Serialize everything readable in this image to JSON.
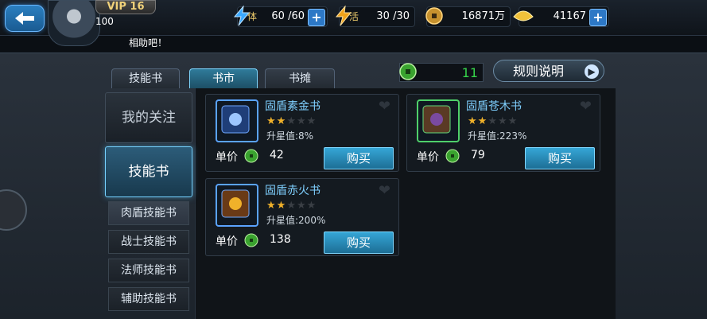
{
  "header": {
    "vip": "VIP 16",
    "level": "100",
    "stamina": {
      "label": "体",
      "value": "60 /60"
    },
    "energy": {
      "label": "活",
      "value": "30 /30"
    },
    "coins": {
      "value": "16871万"
    },
    "gold": {
      "value": "41167"
    },
    "marquee": "相助吧！"
  },
  "tabs": [
    {
      "label": "技能书"
    },
    {
      "label": "书市"
    },
    {
      "label": "书摊"
    }
  ],
  "currency": {
    "value": "11"
  },
  "rules_button": {
    "label": "规则说明"
  },
  "sidebar": {
    "categories": [
      {
        "label": "我的关注"
      },
      {
        "label": "技能书"
      }
    ],
    "subitems": [
      {
        "label": "肉盾技能书"
      },
      {
        "label": "战士技能书"
      },
      {
        "label": "法师技能书"
      },
      {
        "label": "辅助技能书"
      }
    ]
  },
  "cards": [
    {
      "name": "固盾素金书",
      "stars": 2,
      "upgrade": "升星值:8%",
      "price_label": "单价",
      "price": "42",
      "buy": "购买"
    },
    {
      "name": "固盾苍木书",
      "stars": 2,
      "upgrade": "升星值:223%",
      "price_label": "单价",
      "price": "79",
      "buy": "购买"
    },
    {
      "name": "固盾赤火书",
      "stars": 2,
      "upgrade": "升星值:200%",
      "price_label": "单价",
      "price": "138",
      "buy": "购买"
    }
  ],
  "colors": {
    "accent": "#2d78c6",
    "title": "#7fd0ff",
    "currency_green": "#36d34a",
    "star_on": "#f0b12a"
  }
}
